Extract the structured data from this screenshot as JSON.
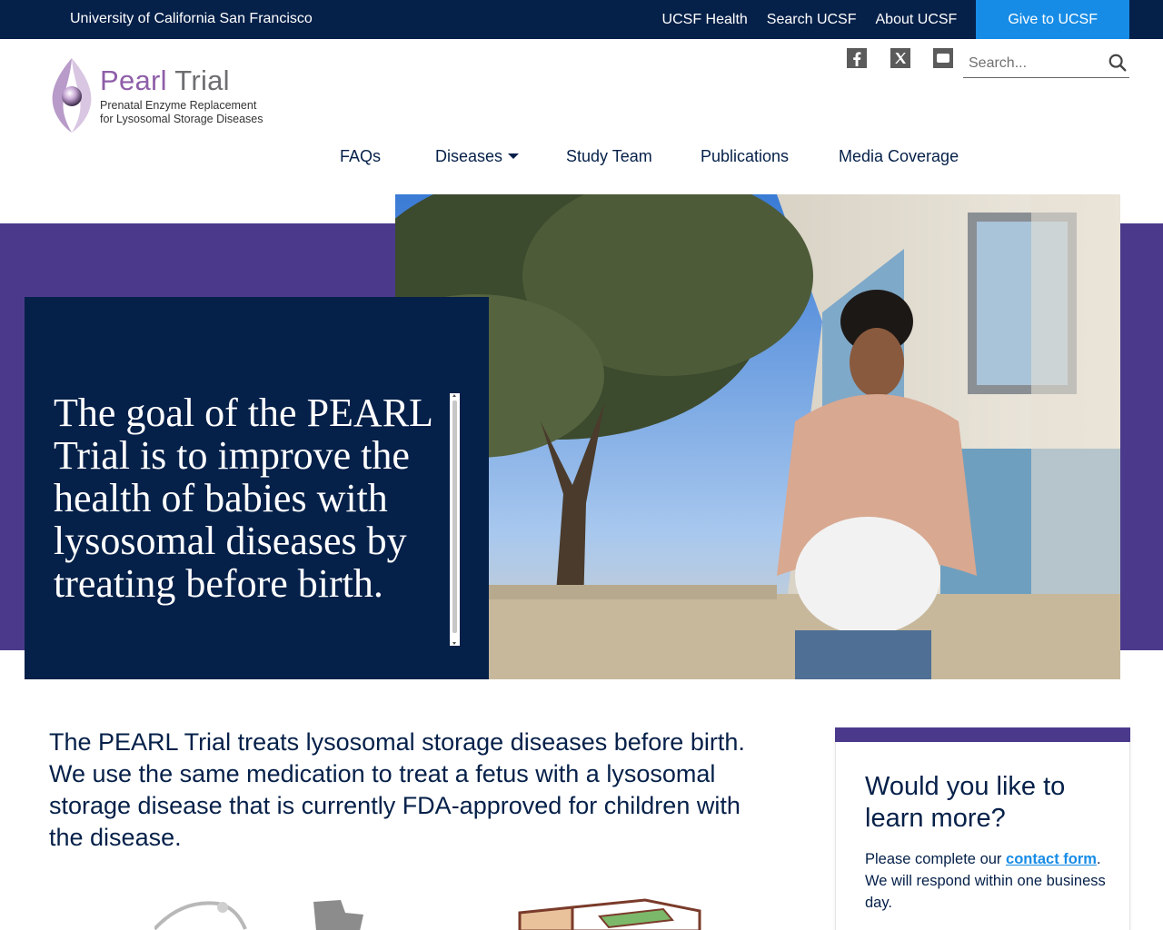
{
  "topbar": {
    "university": "University of California San Francisco",
    "links": [
      "UCSF Health",
      "Search UCSF",
      "About UCSF"
    ],
    "give": "Give to UCSF"
  },
  "logo": {
    "title_a": "Pearl",
    "title_b": "Trial",
    "subtitle_1": "Prenatal Enzyme Replacement",
    "subtitle_2": "for Lysosomal Storage Diseases"
  },
  "social": [
    "facebook-icon",
    "x-icon",
    "youtube-icon"
  ],
  "search": {
    "placeholder": "Search..."
  },
  "nav": {
    "faqs": "FAQs",
    "diseases": "Diseases",
    "study_team": "Study Team",
    "publications": "Publications",
    "media_coverage": "Media Coverage"
  },
  "hero": {
    "text": "The goal of the PEARL Trial is to improve the health of babies with lysosomal diseases by treating before birth."
  },
  "intro": "The PEARL Trial treats lysosomal storage diseases before birth. We use the same medication to treat a fetus with a lysosomal storage disease that is currently FDA-approved for children with the disease.",
  "card": {
    "heading": "Would you like to learn more?",
    "text_before": "Please complete our ",
    "link": "contact form",
    "text_after": ". We will respond within one business day."
  },
  "colors": {
    "navy": "#052049",
    "purple": "#4b3a8c",
    "blue": "#178ce6",
    "logo_purple": "#8e5ea8"
  }
}
